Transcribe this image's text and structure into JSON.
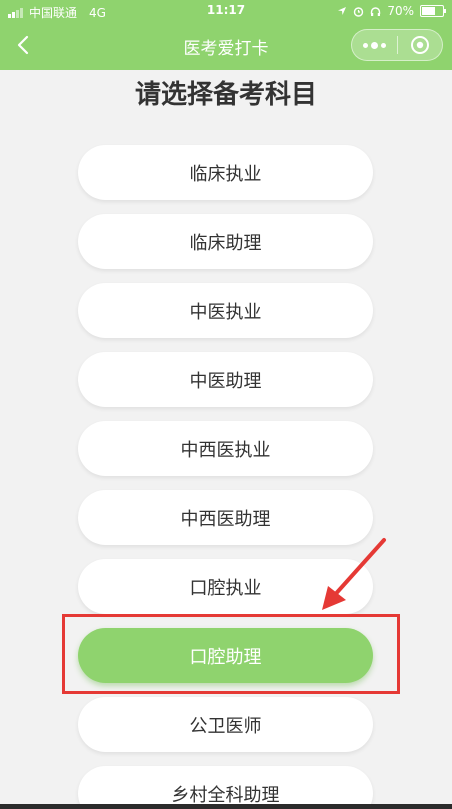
{
  "status_bar": {
    "carrier": "中国联通",
    "network": "4G",
    "time": "11:17",
    "battery_text": "70%",
    "battery_level": 0.7
  },
  "nav": {
    "title": "医考爱打卡"
  },
  "page": {
    "title": "请选择备考科目"
  },
  "subjects": [
    {
      "label": "临床执业",
      "selected": false
    },
    {
      "label": "临床助理",
      "selected": false
    },
    {
      "label": "中医执业",
      "selected": false
    },
    {
      "label": "中医助理",
      "selected": false
    },
    {
      "label": "中西医执业",
      "selected": false
    },
    {
      "label": "中西医助理",
      "selected": false
    },
    {
      "label": "口腔执业",
      "selected": false
    },
    {
      "label": "口腔助理",
      "selected": true
    },
    {
      "label": "公卫医师",
      "selected": false
    },
    {
      "label": "乡村全科助理",
      "selected": false
    }
  ],
  "colors": {
    "accent": "#8fd36e",
    "annotation": "#e53935"
  },
  "icons": {
    "back": "chevron-left-icon",
    "more": "more-dots-icon",
    "close": "target-close-icon"
  }
}
